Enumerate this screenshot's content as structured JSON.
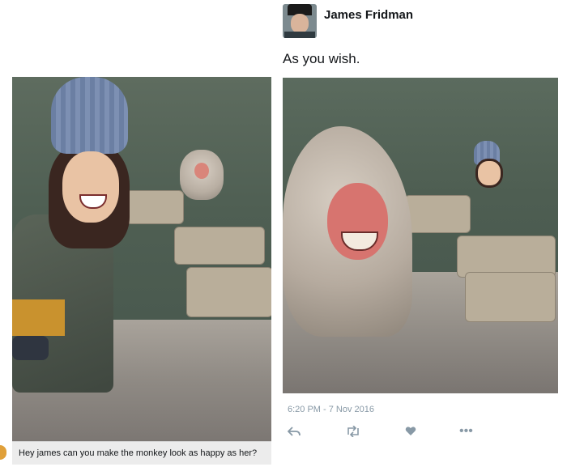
{
  "original_tweet": {
    "caption": "Hey james can you make the monkey look as happy as her?"
  },
  "reply": {
    "author": "James Fridman",
    "text": "As you wish.",
    "timestamp": "6:20 PM - 7 Nov 2016"
  },
  "actions": {
    "reply_icon": "reply-icon",
    "retweet_icon": "retweet-icon",
    "like_icon": "heart-icon",
    "more_icon": "more-icon"
  }
}
